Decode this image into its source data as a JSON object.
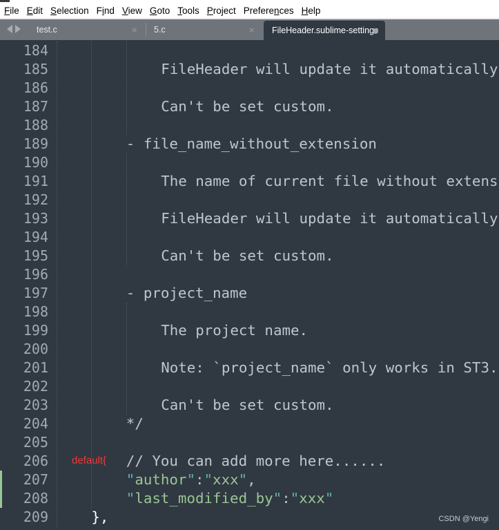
{
  "menu": [
    {
      "label": "File",
      "accel": "F"
    },
    {
      "label": "Edit",
      "accel": "E"
    },
    {
      "label": "Selection",
      "accel": "S"
    },
    {
      "label": "Find",
      "accel": "i"
    },
    {
      "label": "View",
      "accel": "V"
    },
    {
      "label": "Goto",
      "accel": "G"
    },
    {
      "label": "Tools",
      "accel": "T"
    },
    {
      "label": "Project",
      "accel": "P"
    },
    {
      "label": "Preferences",
      "accel": "n"
    },
    {
      "label": "Help",
      "accel": "H"
    }
  ],
  "tabs": [
    {
      "label": "test.c",
      "active": false,
      "close_icon": "×"
    },
    {
      "label": "5.c",
      "active": false,
      "close_icon": "×"
    },
    {
      "label": "FileHeader.sublime-settings",
      "active": true,
      "dirty": true
    }
  ],
  "editor": {
    "lines": [
      {
        "num": "184",
        "indent": 0,
        "text": ""
      },
      {
        "num": "185",
        "indent": 12,
        "text": "FileHeader will update it automatically"
      },
      {
        "num": "186",
        "indent": 0,
        "text": ""
      },
      {
        "num": "187",
        "indent": 12,
        "text": "Can't be set custom."
      },
      {
        "num": "188",
        "indent": 0,
        "text": ""
      },
      {
        "num": "189",
        "indent": 8,
        "text": "- file_name_without_extension"
      },
      {
        "num": "190",
        "indent": 0,
        "text": ""
      },
      {
        "num": "191",
        "indent": 12,
        "text": "The name of current file without extens"
      },
      {
        "num": "192",
        "indent": 0,
        "text": ""
      },
      {
        "num": "193",
        "indent": 12,
        "text": "FileHeader will update it automatically"
      },
      {
        "num": "194",
        "indent": 0,
        "text": ""
      },
      {
        "num": "195",
        "indent": 12,
        "text": "Can't be set custom."
      },
      {
        "num": "196",
        "indent": 0,
        "text": ""
      },
      {
        "num": "197",
        "indent": 8,
        "text": "- project_name"
      },
      {
        "num": "198",
        "indent": 0,
        "text": ""
      },
      {
        "num": "199",
        "indent": 12,
        "text": "The project name."
      },
      {
        "num": "200",
        "indent": 0,
        "text": ""
      },
      {
        "num": "201",
        "indent": 12,
        "text": "Note: `project_name` only works in ST3."
      },
      {
        "num": "202",
        "indent": 0,
        "text": ""
      },
      {
        "num": "203",
        "indent": 12,
        "text": "Can't be set custom."
      },
      {
        "num": "204",
        "indent": 8,
        "text": "*/"
      },
      {
        "num": "205",
        "indent": 0,
        "text": ""
      },
      {
        "num": "206",
        "indent": 8,
        "text": "// You can add more here......"
      },
      {
        "num": "207",
        "indent": 8,
        "key": "author",
        "value": "xxx",
        "trail": ",",
        "modified": true
      },
      {
        "num": "208",
        "indent": 8,
        "key": "last_modified_by",
        "value": "xxx",
        "trail": "",
        "modified": true
      },
      {
        "num": "209",
        "indent": 4,
        "text": "},"
      }
    ],
    "annotation": "default{"
  },
  "watermark": "CSDN @Yengi"
}
